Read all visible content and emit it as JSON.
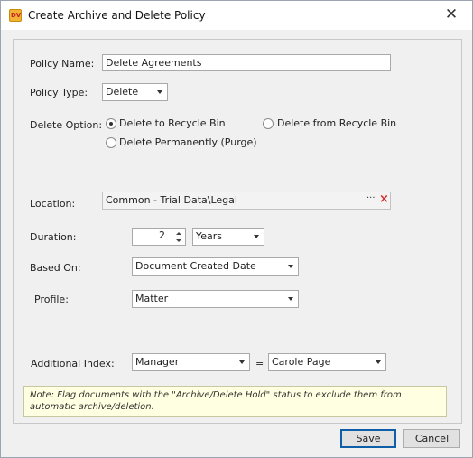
{
  "window": {
    "title": "Create Archive and Delete Policy",
    "icon_text": "DV"
  },
  "form": {
    "policy_name": {
      "label": "Policy Name:",
      "value": "Delete Agreements"
    },
    "policy_type": {
      "label": "Policy Type:",
      "value": "Delete"
    },
    "delete_option": {
      "label": "Delete Option:",
      "options": [
        {
          "label": "Delete to Recycle Bin",
          "checked": true
        },
        {
          "label": "Delete from Recycle Bin",
          "checked": false
        },
        {
          "label": "Delete Permanently (Purge)",
          "checked": false
        }
      ]
    },
    "location": {
      "label": "Location:",
      "value": "Common - Trial Data\\Legal",
      "browse": "···",
      "clear": "×"
    },
    "duration": {
      "label": "Duration:",
      "value": "2",
      "unit": "Years"
    },
    "based_on": {
      "label": "Based On:",
      "value": "Document Created Date"
    },
    "profile": {
      "label": "Profile:",
      "value": "Matter"
    },
    "additional_index": {
      "label": "Additional Index:",
      "field": "Manager",
      "operator": "=",
      "value": "Carole Page"
    }
  },
  "note": "Note: Flag documents with the \"Archive/Delete Hold\" status to exclude them from automatic archive/deletion.",
  "buttons": {
    "save": "Save",
    "cancel": "Cancel"
  }
}
